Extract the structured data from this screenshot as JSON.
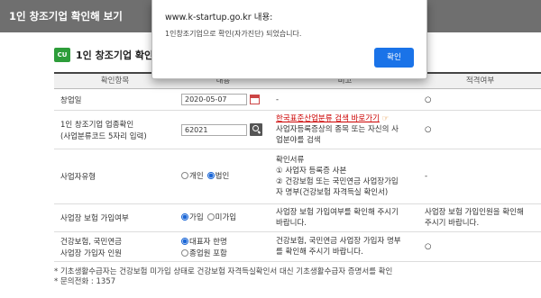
{
  "window": {
    "title": "1인 창조기업 확인해 보기"
  },
  "section": {
    "logo": "CU",
    "title": "1인 창조기업 확인"
  },
  "table": {
    "headers": [
      "확인항목",
      "내용",
      "비고",
      "적격여부"
    ],
    "rows": [
      {
        "label": "창업일",
        "value": "2020-05-07",
        "note": "-",
        "result": "○"
      },
      {
        "label_line1": "1인 창조기업 업종확인",
        "label_line2": "(사업분류코드 5자리 입력)",
        "value": "62021",
        "link_text": "한국표준산업분류 검색 바로가기",
        "note_line1": "사업자등록증상의 종목 또는 자신의 사",
        "note_line2": "업분야를 검색",
        "result": "○"
      },
      {
        "label": "사업자유형",
        "option1": "개인",
        "option2": "법인",
        "note_line1": "확인서류",
        "note_line2": "① 사업자 등록증 사본",
        "note_line3": "② 건강보험 또는 국민연금 사업장가입",
        "note_line4": "자 명부(건강보험 자격득실 확인서)",
        "result": "-"
      },
      {
        "label": "사업장 보험 가입여부",
        "option1": "가입",
        "option2": "미가입",
        "note_line1": "사업장 보험 가입여부를 확인해 주시기",
        "note_line2": "바랍니다.",
        "result_line1": "사업장 보험 가입인원을 확인해",
        "result_line2": "주시기 바랍니다."
      },
      {
        "label_line1": "건강보험, 국민연금",
        "label_line2": "사업장 가입자 인원",
        "option1": "대표자 한명",
        "option2": "종업원 포함",
        "note_line1": "건강보험, 국민연금 사업장 가입자 명부",
        "note_line2": "를 확인해 주시기 바랍니다.",
        "result": "○"
      }
    ]
  },
  "footer": {
    "line1": "* 기초생활수급자는 건강보험 미가입 상태로 건강보험 자격득실확인서 대신 기초생활수급자 증명서를 확인",
    "line2": "* 문의전화 : 1357"
  },
  "dialog": {
    "title": "www.k-startup.go.kr 내용:",
    "message": "1인창조기업으로 확인(자가진단) 되었습니다.",
    "ok_label": "확인"
  },
  "colors": {
    "accent": "#1a73e8",
    "titlebar": "#6f6f6f",
    "link": "#cc0000"
  }
}
